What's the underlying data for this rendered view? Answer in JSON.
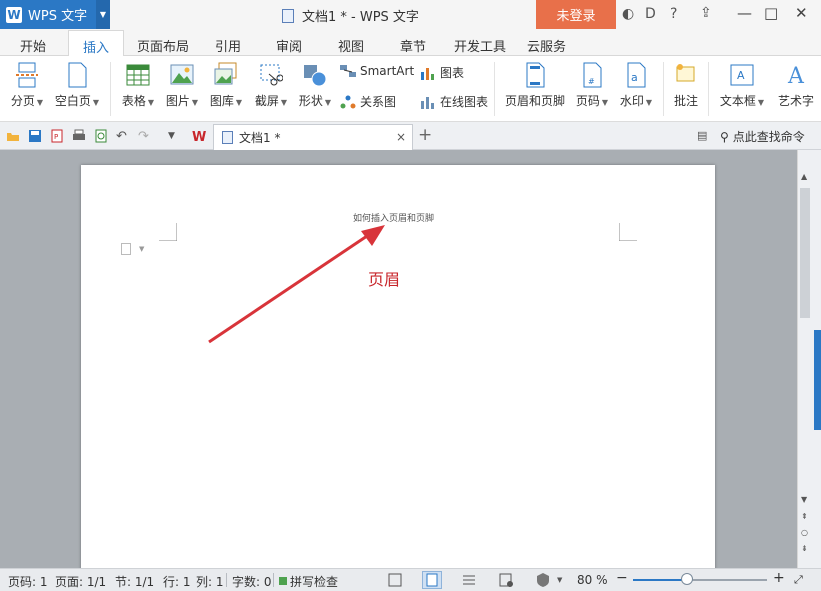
{
  "titlebar": {
    "app_name": "WPS 文字",
    "doc_title": "文档1 * - WPS 文字",
    "login": "未登录"
  },
  "menu": {
    "tabs": [
      "开始",
      "插入",
      "页面布局",
      "引用",
      "审阅",
      "视图",
      "章节",
      "开发工具",
      "云服务"
    ],
    "active": "插入"
  },
  "ribbon": {
    "page_break": "分页",
    "blank_page": "空白页",
    "table": "表格",
    "picture": "图片",
    "gallery": "图库",
    "screenshot": "截屏",
    "shapes": "形状",
    "smartart": "SmartArt",
    "chart": "图表",
    "relation_chart": "关系图",
    "online_chart": "在线图表",
    "header_footer": "页眉和页脚",
    "page_number": "页码",
    "watermark": "水印",
    "comment": "批注",
    "textbox": "文本框",
    "wordart": "艺术字"
  },
  "doctabs": {
    "tab_label": "文档1 *",
    "close": "×",
    "new_tab": "+",
    "search_cmd": "点此查找命令"
  },
  "document": {
    "header_text": "如何插入页眉和页脚",
    "annotation": "页眉",
    "annotation_color": "#c8262b"
  },
  "statusbar": {
    "page_num": "页码: 1",
    "pages": "页面: 1/1",
    "section": "节: 1/1",
    "row": "行: 1",
    "col": "列: 1",
    "words": "字数: 0",
    "spell": "拼写检查",
    "zoom": "80 %",
    "zoom_minus": "−",
    "zoom_plus": "+",
    "zoom_level_fraction": 0.4
  },
  "colors": {
    "accent": "#2b78c5",
    "login_bg": "#e8704a",
    "workspace_bg": "#a9aeb3"
  }
}
